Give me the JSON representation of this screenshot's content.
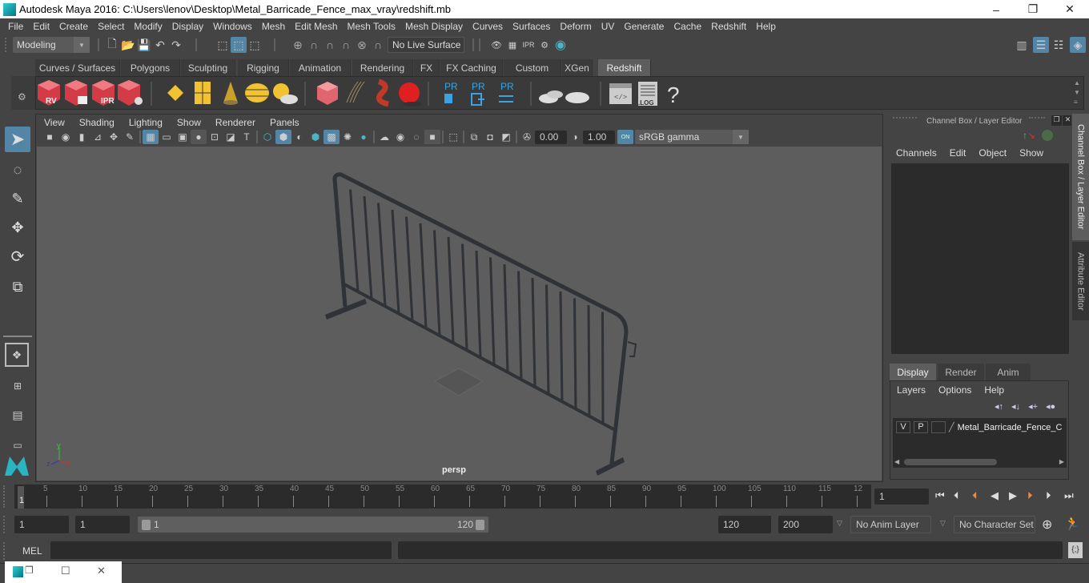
{
  "window": {
    "title": "Autodesk Maya 2016: C:\\Users\\lenov\\Desktop\\Metal_Barricade_Fence_max_vray\\redshift.mb",
    "minimize": "–",
    "restore": "❐",
    "close": "✕"
  },
  "menubar": [
    "File",
    "Edit",
    "Create",
    "Select",
    "Modify",
    "Display",
    "Windows",
    "Mesh",
    "Edit Mesh",
    "Mesh Tools",
    "Mesh Display",
    "Curves",
    "Surfaces",
    "Deform",
    "UV",
    "Generate",
    "Cache",
    "Redshift",
    "Help"
  ],
  "statusline": {
    "menuset": "Modeling",
    "live_surface": "No Live Surface"
  },
  "shelf": {
    "tabs": [
      {
        "label": "Curves / Surfaces",
        "active": false
      },
      {
        "label": "Polygons",
        "active": false
      },
      {
        "label": "Sculpting",
        "active": false
      },
      {
        "label": "Rigging",
        "active": false
      },
      {
        "label": "Animation",
        "active": false
      },
      {
        "label": "Rendering",
        "active": false
      },
      {
        "label": "FX",
        "active": false
      },
      {
        "label": "FX Caching",
        "active": false
      },
      {
        "label": "Custom",
        "active": false
      },
      {
        "label": "XGen",
        "active": false
      },
      {
        "label": "Redshift",
        "active": true
      }
    ],
    "icons": {
      "rv": "RV",
      "ipr": "IPR",
      "pr1": "PR",
      "pr2": "PR",
      "pr3": "PR",
      "log": ".LOG",
      "help": "?"
    }
  },
  "viewport": {
    "menu": [
      "View",
      "Shading",
      "Lighting",
      "Show",
      "Renderer",
      "Panels"
    ],
    "exposure": "0.00",
    "gamma": "1.00",
    "color_mgmt": "ON",
    "colorspace": "sRGB gamma",
    "camera_label": "persp",
    "axis": {
      "x": "x",
      "y": "y",
      "z": "z"
    }
  },
  "channel_box": {
    "title": "Channel Box / Layer Editor",
    "menu": [
      "Channels",
      "Edit",
      "Object",
      "Show"
    ]
  },
  "layer_editor": {
    "tabs": [
      {
        "label": "Display",
        "active": true
      },
      {
        "label": "Render",
        "active": false
      },
      {
        "label": "Anim",
        "active": false
      }
    ],
    "menu": [
      "Layers",
      "Options",
      "Help"
    ],
    "layers": [
      {
        "v": "V",
        "p": "P",
        "name": "Metal_Barricade_Fence_C"
      }
    ]
  },
  "side_tabs": [
    "Channel Box / Layer Editor",
    "Attribute Editor"
  ],
  "timeline": {
    "ticks": [
      "5",
      "10",
      "15",
      "20",
      "25",
      "30",
      "35",
      "40",
      "45",
      "50",
      "55",
      "60",
      "65",
      "70",
      "75",
      "80",
      "85",
      "90",
      "95",
      "100",
      "105",
      "110",
      "115",
      "12"
    ],
    "current_marker": "1",
    "current_frame": "1"
  },
  "range": {
    "start": "1",
    "playback_start": "1",
    "slider_start": "1",
    "slider_end": "120",
    "playback_end": "120",
    "end": "200",
    "anim_layer": "No Anim Layer",
    "character_set": "No Character Set"
  },
  "command": {
    "label": "MEL",
    "input": "",
    "output": ""
  }
}
